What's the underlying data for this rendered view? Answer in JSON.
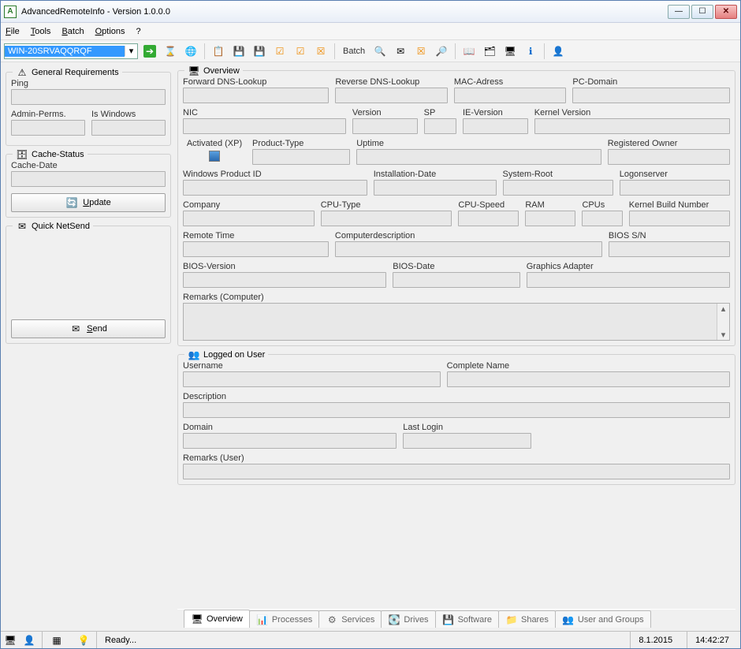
{
  "title": "AdvancedRemoteInfo - Version 1.0.0.0",
  "menu": {
    "file": "File",
    "tools": "Tools",
    "batch": "Batch",
    "options": "Options",
    "help": "?"
  },
  "combo_value": "WIN-20SRVAQQRQF",
  "toolbar_batch": "Batch",
  "left": {
    "general": {
      "title": "General Requirements",
      "ping": "Ping",
      "admin": "Admin-Perms.",
      "iswin": "Is Windows"
    },
    "cache": {
      "title": "Cache-Status",
      "date": "Cache-Date",
      "update": "Update"
    },
    "netsend": {
      "title": "Quick NetSend",
      "send": "Send"
    }
  },
  "overview": {
    "title": "Overview",
    "fwd_dns": "Forward DNS-Lookup",
    "rev_dns": "Reverse DNS-Lookup",
    "mac": "MAC-Adress",
    "pcdomain": "PC-Domain",
    "nic": "NIC",
    "version": "Version",
    "sp": "SP",
    "ie": "IE-Version",
    "kernel": "Kernel Version",
    "activated": "Activated (XP)",
    "ptype": "Product-Type",
    "uptime": "Uptime",
    "regowner": "Registered Owner",
    "wpid": "Windows Product ID",
    "instdate": "Installation-Date",
    "sysroot": "System-Root",
    "logon": "Logonserver",
    "company": "Company",
    "cputype": "CPU-Type",
    "cpuspeed": "CPU-Speed",
    "ram": "RAM",
    "cpus": "CPUs",
    "kbn": "Kernel Build Number",
    "rtime": "Remote Time",
    "cdesc": "Computerdescription",
    "biossn": "BIOS S/N",
    "biosver": "BIOS-Version",
    "biosdate": "BIOS-Date",
    "gfx": "Graphics Adapter",
    "remarks": "Remarks (Computer)"
  },
  "user": {
    "title": "Logged on User",
    "username": "Username",
    "cname": "Complete Name",
    "desc": "Description",
    "domain": "Domain",
    "lastlogin": "Last Login",
    "remarks": "Remarks (User)"
  },
  "tabs": {
    "overview": "Overview",
    "processes": "Processes",
    "services": "Services",
    "drives": "Drives",
    "software": "Software",
    "shares": "Shares",
    "users": "User and Groups"
  },
  "status": {
    "ready": "Ready...",
    "date": "8.1.2015",
    "time": "14:42:27"
  }
}
